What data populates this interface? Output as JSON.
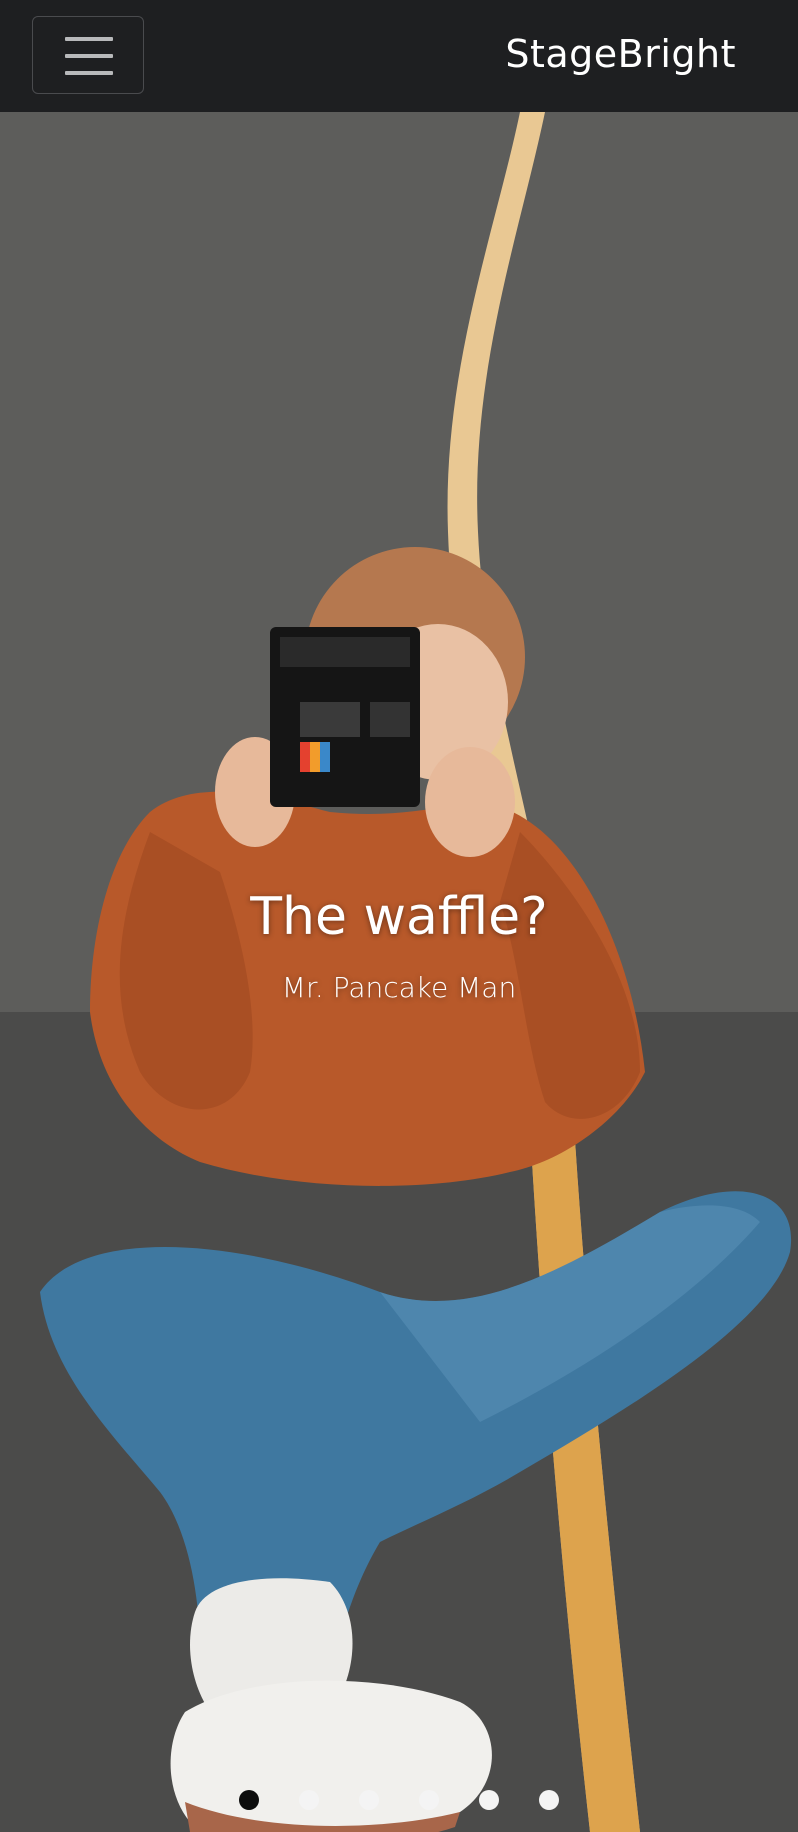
{
  "navbar": {
    "brand": "StageBright",
    "menu_icon": "hamburger-menu-icon"
  },
  "carousel": {
    "slides": [
      {
        "title": "The waffle?",
        "subtitle": "Mr. Pancake Man"
      }
    ],
    "indicator_count": 6,
    "active_index": 0
  },
  "colors": {
    "navbar_bg": "#1e1f21",
    "active_dot": "#0d0d0d",
    "inactive_dot": "#f4f4f4"
  }
}
